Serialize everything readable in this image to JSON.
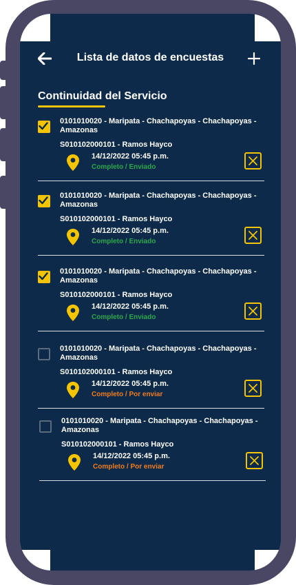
{
  "header": {
    "title": "Lista de datos de encuestas",
    "back_icon": "arrow-left-icon",
    "add_icon": "plus-icon"
  },
  "section": {
    "title": "Continuidad del Servicio"
  },
  "colors": {
    "background": "#0d2a4a",
    "accent": "#f5c400",
    "status_sent": "#2aa84a",
    "status_pending": "#f07d1a"
  },
  "items": [
    {
      "checked": true,
      "location": "0101010020 - Maripata - Chachapoyas - Chachapoyas - Amazonas",
      "code": "S010102000101 - Ramos Hayco",
      "date": "14/12/2022 05:45 p.m.",
      "status": "Completo / Enviado",
      "status_type": "sent"
    },
    {
      "checked": true,
      "location": "0101010020 - Maripata - Chachapoyas - Chachapoyas - Amazonas",
      "code": "S010102000101 - Ramos Hayco",
      "date": "14/12/2022 05:45 p.m.",
      "status": "Completo / Enviado",
      "status_type": "sent"
    },
    {
      "checked": true,
      "location": "0101010020 - Maripata - Chachapoyas - Chachapoyas - Amazonas",
      "code": "S010102000101 - Ramos Hayco",
      "date": "14/12/2022 05:45 p.m.",
      "status": "Completo / Enviado",
      "status_type": "sent"
    },
    {
      "checked": false,
      "location": "0101010020 - Maripata - Chachapoyas - Chachapoyas - Amazonas",
      "code": "S010102000101 - Ramos Hayco",
      "date": "14/12/2022 05:45 p.m.",
      "status": "Completo / Por enviar",
      "status_type": "pending"
    },
    {
      "checked": false,
      "location": "0101010020 - Maripata - Chachapoyas - Chachapoyas - Amazonas",
      "code": "S010102000101 - Ramos Hayco",
      "date": "14/12/2022 05:45 p.m.",
      "status": "Completo / Por enviar",
      "status_type": "pending"
    }
  ]
}
